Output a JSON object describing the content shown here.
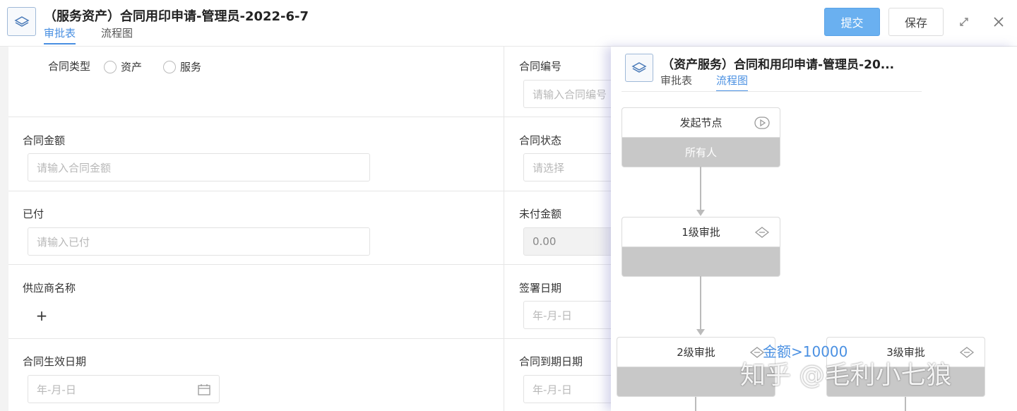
{
  "header": {
    "title": "（服务资产）合同用印申请-管理员-2022-6-7",
    "tabs": [
      "审批表",
      "流程图"
    ],
    "submit_label": "提交",
    "save_label": "保存"
  },
  "form": {
    "contract_type": {
      "label": "合同类型",
      "options": [
        "资产",
        "服务"
      ]
    },
    "contract_no": {
      "label": "合同编号",
      "placeholder": "请输入合同编号"
    },
    "contract_amount": {
      "label": "合同金额",
      "placeholder": "请输入合同金额"
    },
    "contract_status": {
      "label": "合同状态",
      "placeholder": "请选择"
    },
    "paid": {
      "label": "已付",
      "placeholder": "请输入已付"
    },
    "unpaid": {
      "label": "未付金额",
      "value": "0.00"
    },
    "supplier": {
      "label": "供应商名称",
      "add_symbol": "+"
    },
    "sign_date": {
      "label": "签署日期",
      "placeholder": "年-月-日"
    },
    "effective_date": {
      "label": "合同生效日期",
      "placeholder": "年-月-日"
    },
    "expiry_date": {
      "label": "合同到期日期",
      "placeholder": "年-月-日"
    }
  },
  "overlay": {
    "title": "（资产服务）合同和用印申请-管理员-20...",
    "tabs": [
      "审批表",
      "流程图"
    ],
    "nodes": [
      {
        "title": "发起节点",
        "body": "所有人",
        "icon": "play-icon"
      },
      {
        "title": "1级审批",
        "body": "",
        "icon": "approval-icon"
      },
      {
        "title": "2级审批",
        "body": "",
        "icon": "approval-icon"
      },
      {
        "title": "3级审批",
        "body": "",
        "icon": "approval-icon"
      }
    ],
    "condition": "金额>10000",
    "watermark": "知乎 @毛利小七狼"
  },
  "colors": {
    "accent": "#4a90e2",
    "submit_bg": "#6ab0f0",
    "node_body": "#c8c8c8"
  }
}
